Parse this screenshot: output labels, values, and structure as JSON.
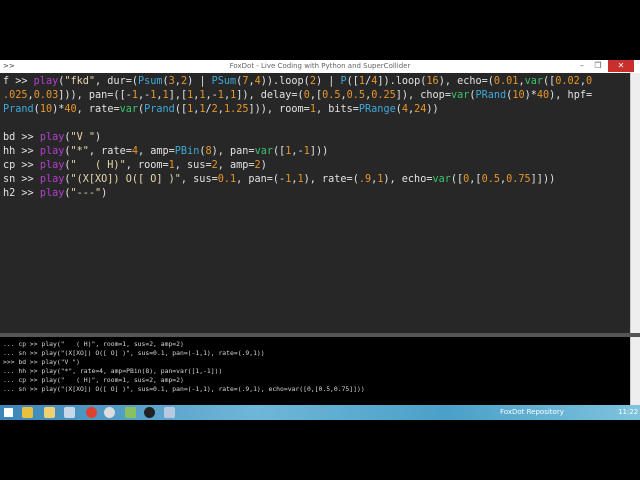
{
  "window": {
    "app_prefix": ">>",
    "title": "FoxDot - Live Coding with Python and SuperCollider",
    "controls": {
      "minimize": "–",
      "maximize": "❐",
      "close": "✕"
    }
  },
  "editor": {
    "lines": [
      "f >> play(\"fkd\", dur=(Psum(3,2) | PSum(7,4)).loop(2) | P([1/4]).loop(16), echo=(0.01,var([0.02,0",
      ".025,0.03])), pan=([-1,-1,1],[1,1,-1,1]), delay=(0,[0.5,0.5,0.25]), chop=var(PRand(10)*40), hpf=",
      "Prand(10)*40, rate=var(Prand([1,1/2,1.25])), room=1, bits=PRange(4,24))",
      "",
      "bd >> play(\"V \")",
      "hh >> play(\"*\", rate=4, amp=PBin(8), pan=var([1,-1]))",
      "cp >> play(\"   ( H)\", room=1, sus=2, amp=2)",
      "sn >> play(\"(X[XO]) O([ O] )\", sus=0.1, pan=(-1,1), rate=(.9,1), echo=var([0,[0.5,0.75]]))",
      "h2 >> play(\"---\")"
    ]
  },
  "console": {
    "lines": [
      "... cp >> play(\"   ( H)\", room=1, sus=2, amp=2)",
      "... sn >> play(\"(X[XO]) O([ O] )\", sus=0.1, pan=(-1,1), rate=(.9,1))",
      ">>> bd >> play(\"V \")",
      "... hh >> play(\"*\", rate=4, amp=PBin(8), pan=var([1,-1]))",
      "... cp >> play(\"   ( H)\", room=1, sus=2, amp=2)",
      "... sn >> play(\"(X[XO]) O([ O] )\", sus=0.1, pan=(-1,1), rate=(.9,1), echo=var([0,[0.5,0.75]]))"
    ]
  },
  "taskbar": {
    "tray_label": "FoxDot Repository",
    "clock": "11:22",
    "apps": [
      "start-icon",
      "chrome-drive-icon",
      "file-explorer-icon",
      "paint-icon",
      "chrome-icon",
      "obs-icon",
      "photos-icon",
      "supercollider-icon",
      "foxdot-icon"
    ]
  },
  "colors": {
    "close": "#c7302b",
    "editor_bg": "#272727",
    "play": "#b43fd0",
    "string": "#ead9aa",
    "number": "#e8962a",
    "pattern": "#3fa9d8",
    "var": "#3cc46c"
  }
}
